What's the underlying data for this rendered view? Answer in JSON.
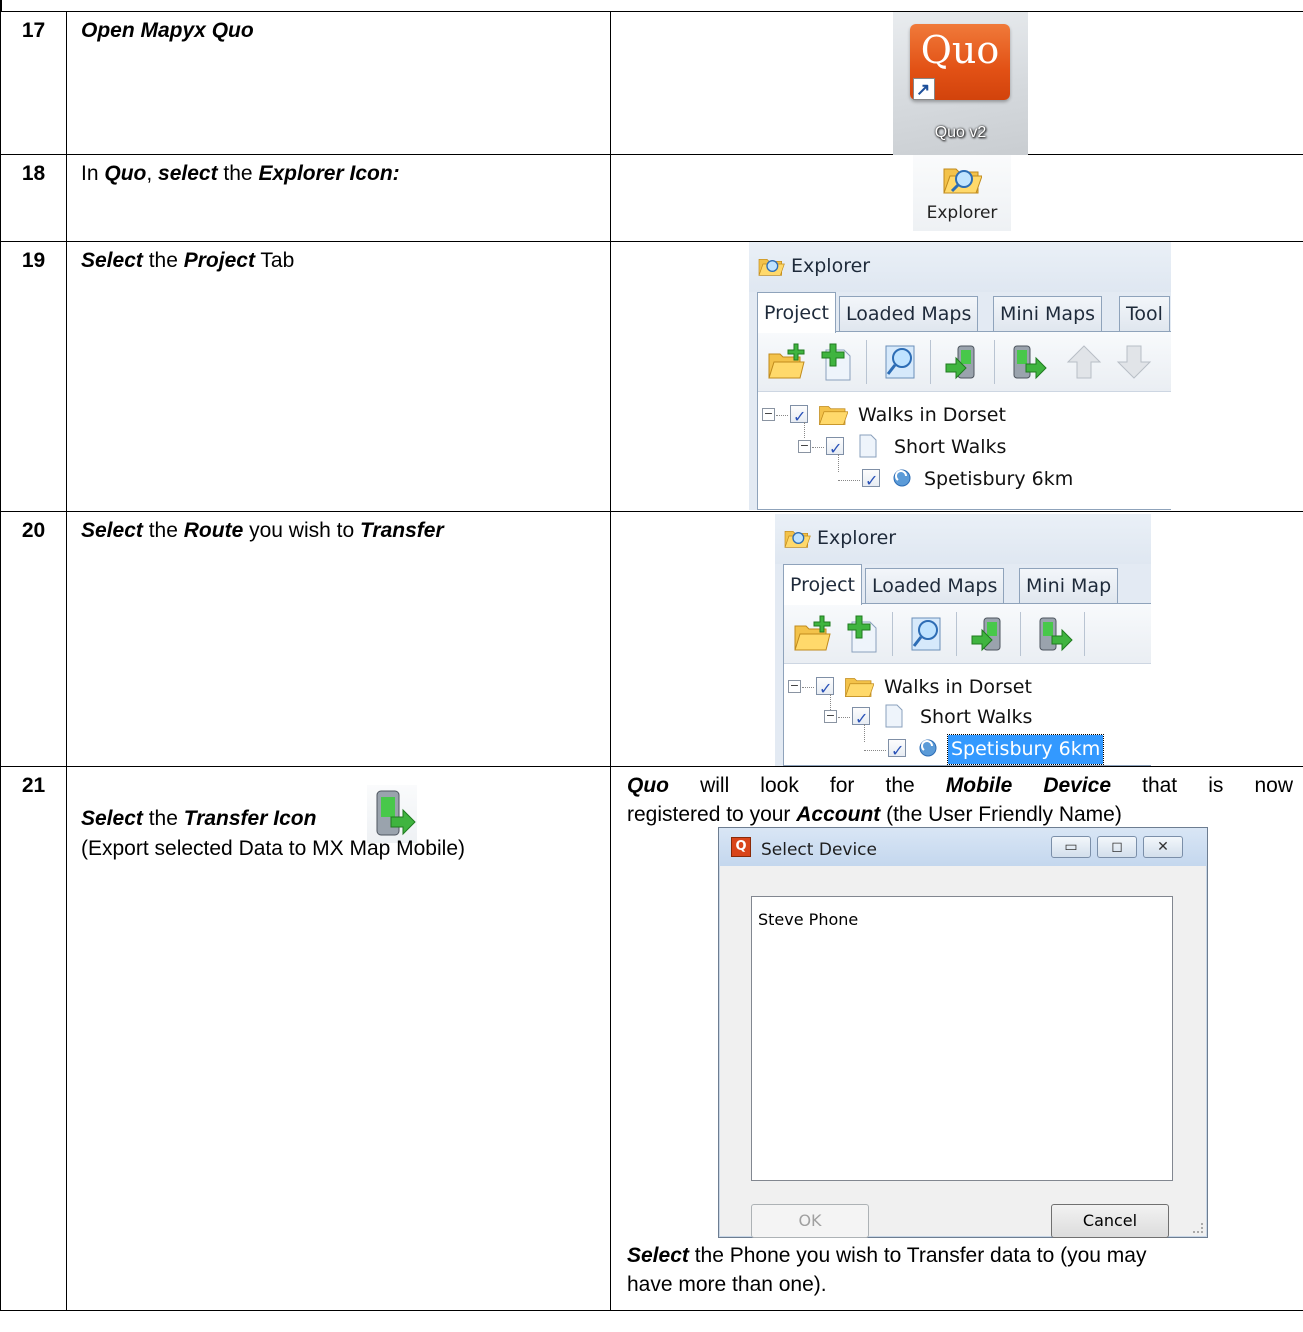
{
  "steps": [
    {
      "number": "17",
      "instruction": {
        "bold1": "Open Mapyx Quo"
      },
      "image": {
        "logo_text": "Quo",
        "caption": "Quo v2"
      }
    },
    {
      "number": "18",
      "instruction": {
        "t1": "In ",
        "b1": "Quo",
        "t2": ", ",
        "b2": "select",
        "t3": " the ",
        "b3": "Explorer Icon:"
      },
      "image": {
        "caption": "Explorer"
      }
    },
    {
      "number": "19",
      "instruction": {
        "b1": "Select",
        "t1": " the ",
        "b2": "Project",
        "t2": " Tab"
      },
      "image": {
        "title": "Explorer",
        "tabs": [
          "Project",
          "Loaded Maps",
          "Mini Maps",
          "Tool"
        ],
        "tree": [
          "Walks in Dorset",
          "Short Walks",
          "Spetisbury 6km"
        ]
      }
    },
    {
      "number": "20",
      "instruction": {
        "b1": "Select",
        "t1": " the ",
        "b2": "Route",
        "t2": " you wish to ",
        "b3": "Transfer"
      },
      "image": {
        "title": "Explorer",
        "tabs": [
          "Project",
          "Loaded Maps",
          "Mini Map"
        ],
        "tree": [
          "Walks in Dorset",
          "Short Walks",
          "Spetisbury 6km"
        ]
      }
    },
    {
      "number": "21",
      "instruction": {
        "b1": "Select",
        "t1": " the ",
        "b2": "Transfer Icon",
        "line2": "(Export selected Data to MX Map Mobile)"
      },
      "right_text": {
        "b1": "Quo",
        "t1": " will look for the ",
        "b2": "Mobile Device",
        "t2": " that is now",
        "t3": "registered to your ",
        "b3": "Account",
        "t4": " (the User Friendly Name)",
        "b4": "Select",
        "t5": " the Phone you wish to Transfer data to (you may",
        "t6": "have more than one)."
      },
      "dialog": {
        "title": "Select Device",
        "app_icon": "Q",
        "list_items": [
          "Steve Phone"
        ],
        "ok_label": "OK",
        "cancel_label": "Cancel"
      }
    }
  ]
}
